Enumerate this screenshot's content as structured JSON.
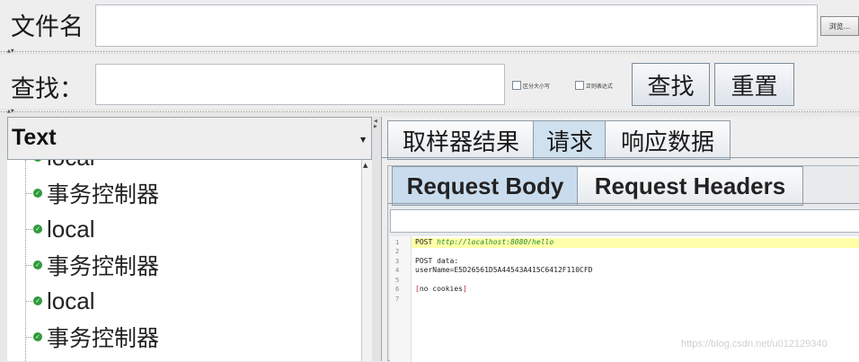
{
  "file_row": {
    "label": "文件名",
    "browse_button": "浏览..."
  },
  "search_row": {
    "label": "查找：",
    "case_checkbox": "区分大小写",
    "regex_checkbox": "正则表达式",
    "find_button": "查找",
    "reset_button": "重置"
  },
  "tree": {
    "combo_value": "Text",
    "items": [
      {
        "label": "local",
        "icon": "success-shield-icon"
      },
      {
        "label": "事务控制器",
        "icon": "success-shield-icon"
      },
      {
        "label": "local",
        "icon": "success-shield-icon"
      },
      {
        "label": "事务控制器",
        "icon": "success-shield-icon"
      },
      {
        "label": "local",
        "icon": "success-shield-icon"
      },
      {
        "label": "事务控制器",
        "icon": "success-shield-icon"
      }
    ]
  },
  "result_tabs": [
    {
      "label": "取样器结果",
      "active": false
    },
    {
      "label": "请求",
      "active": true
    },
    {
      "label": "响应数据",
      "active": false
    }
  ],
  "request_tabs": [
    {
      "label": "Request Body",
      "active": true
    },
    {
      "label": "Request Headers",
      "active": false
    }
  ],
  "editor": {
    "line_numbers": [
      "1",
      "2",
      "3",
      "4",
      "5",
      "6",
      "7"
    ],
    "line1_method": "POST ",
    "line1_url": "http://localhost:8080/hello",
    "line3": "POST data:",
    "line4": "userName=E5D26561D5A44543A415C6412F110CFD",
    "line6_open": "[",
    "line6_text": "no cookies",
    "line6_close": "]"
  },
  "watermark": "https://blog.csdn.net/u012129340",
  "colors": {
    "success_green": "#2f9a3a",
    "active_tab": "#cfe0ee",
    "highlight_line": "#ffffaa",
    "url_green": "#2a8a2a"
  }
}
